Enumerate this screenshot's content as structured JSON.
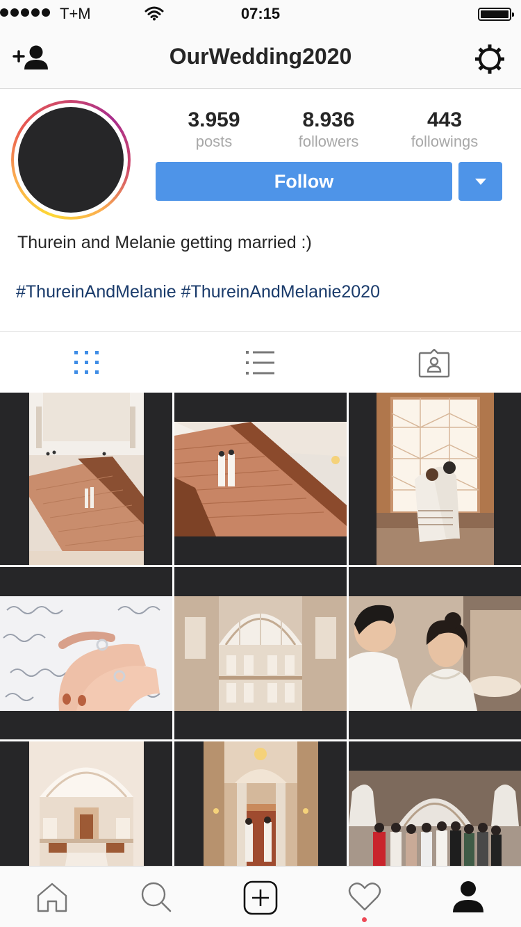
{
  "status_bar": {
    "carrier": "T+M",
    "time": "07:15",
    "signal_icon": "signal-dots-icon",
    "wifi_icon": "wifi-icon",
    "battery_icon": "battery-icon",
    "battery_level": 1.0
  },
  "nav": {
    "title": "OurWedding2020",
    "left_icon": "add-user-icon",
    "right_icon": "gear-icon"
  },
  "profile": {
    "stats": [
      {
        "value": "3.959",
        "label": "posts"
      },
      {
        "value": "8.936",
        "label": "followers"
      },
      {
        "value": "443",
        "label": "followings"
      }
    ],
    "follow_label": "Follow",
    "dropdown_icon": "caret-down-icon",
    "bio": "Thurein and Melanie getting married :)",
    "hashtags": [
      "#ThureinAndMelanie",
      "#ThureinAndMelanie2020"
    ]
  },
  "view_tabs": [
    {
      "icon": "grid-icon",
      "active": true
    },
    {
      "icon": "list-icon",
      "active": false
    },
    {
      "icon": "tagged-person-icon",
      "active": false
    }
  ],
  "posts": [
    {
      "subject": "grand staircase with couple",
      "tone": "warm marble"
    },
    {
      "subject": "couple on staircase",
      "tone": "copper stairs"
    },
    {
      "subject": "couple at window",
      "tone": "amber"
    },
    {
      "subject": "hands with rings",
      "tone": "white lace"
    },
    {
      "subject": "rotunda interior",
      "tone": "pale stone"
    },
    {
      "subject": "couple close portrait",
      "tone": "neutral"
    },
    {
      "subject": "rotunda staircase",
      "tone": "cream"
    },
    {
      "subject": "couple at doorway",
      "tone": "golden"
    },
    {
      "subject": "family group photo",
      "tone": "grey stone"
    }
  ],
  "bottom_tabs": [
    {
      "icon": "home-icon"
    },
    {
      "icon": "search-icon"
    },
    {
      "icon": "add-post-icon"
    },
    {
      "icon": "heart-icon",
      "has_notification": true
    },
    {
      "icon": "profile-icon",
      "active": true
    }
  ],
  "colors": {
    "accent": "#4e94e8",
    "hashtag": "#1a3b6b",
    "grid_bg": "#262628",
    "notification": "#ed4956"
  }
}
